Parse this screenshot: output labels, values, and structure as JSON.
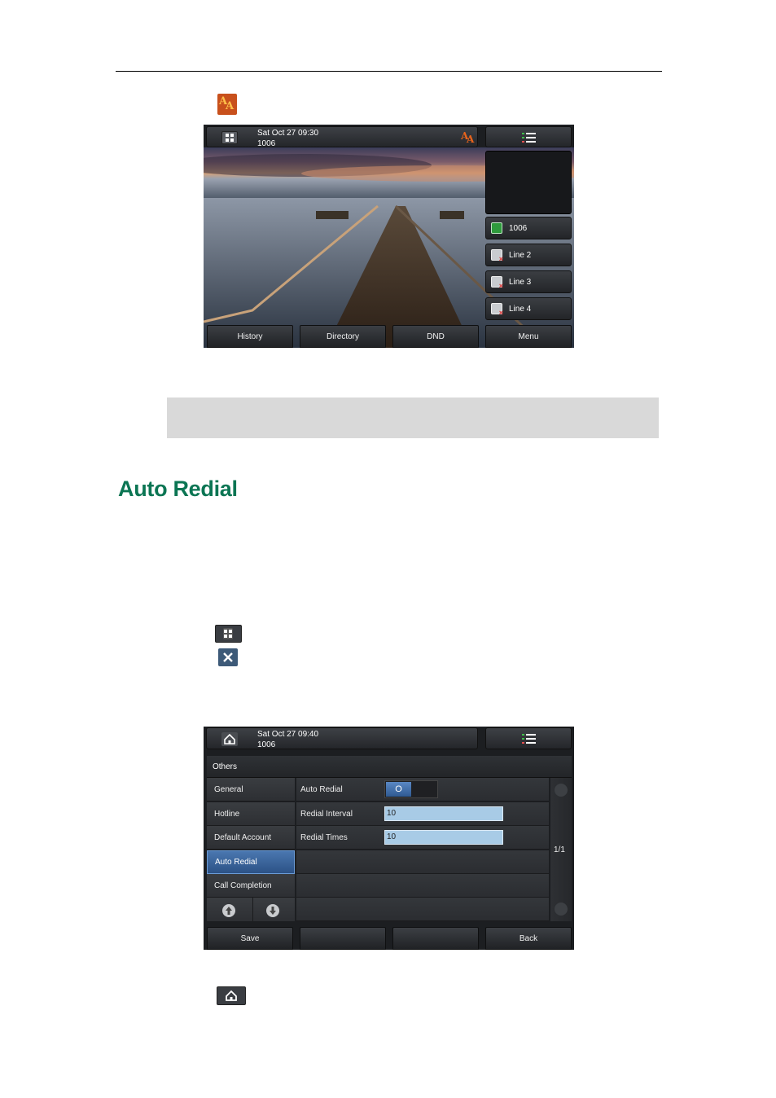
{
  "screen1": {
    "status": {
      "datetime": "Sat Oct 27 09:30",
      "account": "1006"
    },
    "line_keys": [
      {
        "label": "1006",
        "icon": "registered-phone-icon"
      },
      {
        "label": "Line 2",
        "icon": "unregistered-line-icon"
      },
      {
        "label": "Line 3",
        "icon": "unregistered-line-icon"
      },
      {
        "label": "Line 4",
        "icon": "unregistered-line-icon"
      }
    ],
    "softkeys": [
      "History",
      "Directory",
      "DND",
      "Menu"
    ]
  },
  "section": {
    "title": "Auto Redial"
  },
  "screen2": {
    "status": {
      "datetime": "Sat Oct 27 09:40",
      "account": "1006"
    },
    "breadcrumb": "Others",
    "menu": [
      "General",
      "Hotline",
      "Default Account",
      "Auto Redial",
      "Call Completion"
    ],
    "active_menu": "Auto Redial",
    "settings": [
      {
        "label": "Auto Redial",
        "type": "toggle",
        "value": "O"
      },
      {
        "label": "Redial Interval",
        "type": "input",
        "value": "10"
      },
      {
        "label": "Redial Times",
        "type": "input",
        "value": "10"
      }
    ],
    "page_indicator": "1/1",
    "softkeys": [
      "Save",
      "",
      "",
      "Back"
    ]
  },
  "colors": {
    "heading": "#0b7553",
    "active_item": "#2c5286",
    "field": "#a8cbe6"
  }
}
